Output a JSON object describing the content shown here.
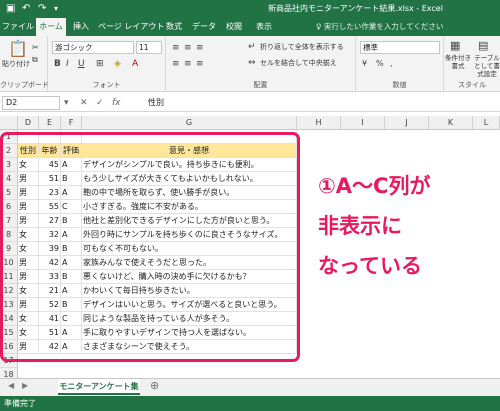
{
  "window": {
    "title": "新商品社内モニターアンケート結果.xlsx - Excel"
  },
  "qat": {
    "save_icon": "save-icon",
    "undo_icon": "undo-icon",
    "redo_icon": "redo-icon"
  },
  "tabs": [
    "ファイル",
    "ホーム",
    "挿入",
    "ページ レイアウト",
    "数式",
    "データ",
    "校閲",
    "表示"
  ],
  "tell_me": "♀ 実行したい作業を入力してください",
  "ribbon": {
    "clipboard": {
      "paste": "貼り付け",
      "label": "クリップボード"
    },
    "font": {
      "name": "游ゴシック",
      "size": "11",
      "bold": "B",
      "italic": "I",
      "underline": "U",
      "label": "フォント"
    },
    "alignment": {
      "wrap": "折り返して全体を表示する",
      "merge": "セルを結合して中央揃え",
      "label": "配置"
    },
    "number": {
      "format": "標準",
      "label": "数値"
    },
    "styles": {
      "conditional": "条件付き書式",
      "table": "テーブルとして書式設定",
      "label": "スタイル"
    }
  },
  "formula_bar": {
    "name_box": "D2",
    "content": "性別"
  },
  "columns": [
    "D",
    "E",
    "F",
    "G",
    "H",
    "I",
    "J",
    "K",
    "L"
  ],
  "rows": [
    "1",
    "2",
    "3",
    "4",
    "5",
    "6",
    "7",
    "8",
    "9",
    "10",
    "11",
    "12",
    "13",
    "14",
    "15",
    "16",
    "17",
    "18"
  ],
  "table": {
    "headers": [
      "性別",
      "年齢",
      "評価",
      "意見・感想"
    ],
    "rows": [
      [
        "女",
        "45",
        "A",
        "デザインがシンプルで良い。持ち歩きにも便利。"
      ],
      [
        "男",
        "51",
        "B",
        "もう少しサイズが大きくてもよいかもしれない。"
      ],
      [
        "男",
        "23",
        "A",
        "鞄の中で場所を取らず、使い勝手が良い。"
      ],
      [
        "男",
        "55",
        "C",
        "小さすぎる。強度に不安がある。"
      ],
      [
        "男",
        "27",
        "B",
        "他社と差別化できるデザインにした方が良いと思う。"
      ],
      [
        "女",
        "32",
        "A",
        "外回り時にサンプルを持ち歩くのに良さそうなサイズ。"
      ],
      [
        "女",
        "39",
        "B",
        "可もなく不可もない。"
      ],
      [
        "男",
        "42",
        "A",
        "家族みんなで使えそうだと思った。"
      ],
      [
        "男",
        "33",
        "B",
        "悪くないけど、購入時の決め手に欠けるかも？"
      ],
      [
        "女",
        "21",
        "A",
        "かわいくて毎日持ち歩きたい。"
      ],
      [
        "男",
        "52",
        "B",
        "デザインはいいと思う。サイズが選べると良いと思う。"
      ],
      [
        "女",
        "41",
        "C",
        "同じような製品を持っている人が多そう。"
      ],
      [
        "女",
        "51",
        "A",
        "手に取りやすいデザインで持つ人を選ばない。"
      ],
      [
        "男",
        "42",
        "A",
        "さまざまなシーンで使えそう。"
      ]
    ]
  },
  "annotation": {
    "line1": "①A～C列が",
    "line2": "非表示に",
    "line3": "なっている"
  },
  "sheet_tab": "モニターアンケート集計",
  "status": "準備完了",
  "colors": {
    "excel_green": "#217346",
    "header_fill": "#ffe699",
    "highlight": "#e8195e"
  }
}
